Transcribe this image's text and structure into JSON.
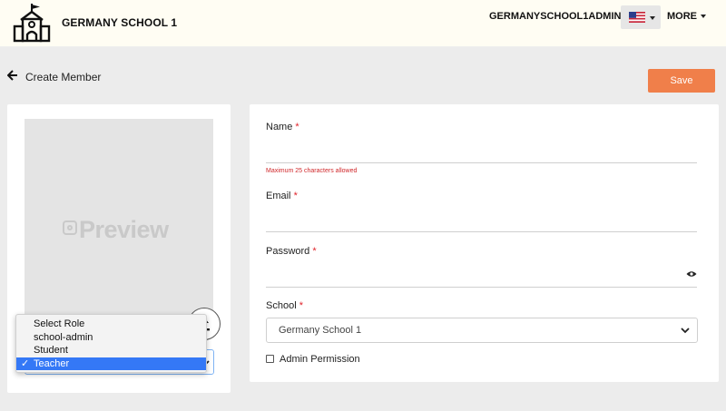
{
  "header": {
    "school_name": "GERMANY SCHOOL 1",
    "admin_name": "GERMANYSCHOOL1ADMIN",
    "more_label": "MORE"
  },
  "page": {
    "title": "Create Member",
    "save_label": "Save"
  },
  "preview": {
    "label": "Preview"
  },
  "role_select": {
    "options": [
      "Select Role",
      "school-admin",
      "Student",
      "Teacher"
    ],
    "selected": "Teacher"
  },
  "form": {
    "name_label": "Name",
    "name_hint": "Maximum 25 characters allowed",
    "email_label": "Email",
    "password_label": "Password",
    "school_label": "School",
    "school_value": "Germany School 1",
    "admin_permission_label": "Admin Permission",
    "required_mark": "*"
  },
  "colors": {
    "accent": "#f07f4a",
    "required": "#e0242b",
    "selection": "#3478f6",
    "header_bg": "#fffdf3"
  }
}
